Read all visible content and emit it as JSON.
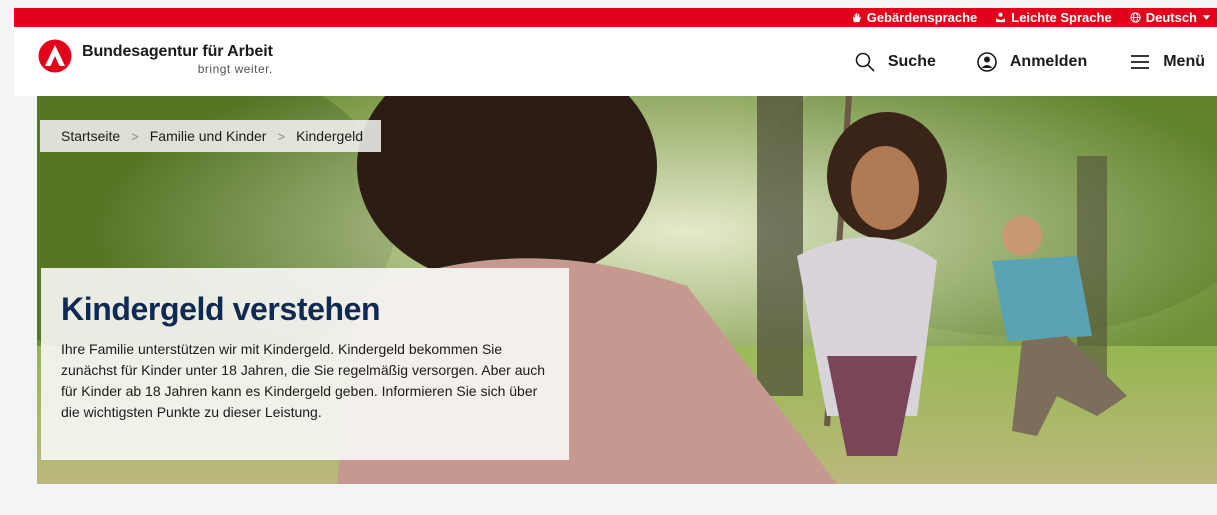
{
  "topbar": {
    "sign_language": "Gebärdensprache",
    "easy_language": "Leichte Sprache",
    "language": "Deutsch",
    "color": "#e2001a"
  },
  "header": {
    "brand_name": "Bundesagentur für Arbeit",
    "brand_claim": "bringt weiter.",
    "search_label": "Suche",
    "login_label": "Anmelden",
    "menu_label": "Menü"
  },
  "breadcrumb": {
    "items": [
      "Startseite",
      "Familie und Kinder",
      "Kindergeld"
    ],
    "separator": ">"
  },
  "hero": {
    "title": "Kindergeld verstehen",
    "text": "Ihre Familie unterstützen wir mit Kindergeld. Kindergeld bekommen Sie zunächst für Kinder unter 18 Jahren, die Sie regelmäßig versorgen. Aber auch für Kinder ab 18 Jahren kann es Kindergeld geben. Informieren Sie sich über die wichtigsten Punkte zu dieser Leistung."
  },
  "icons": {
    "sign_language": "hand-icon",
    "easy_language": "easy-language-icon",
    "language": "globe-icon",
    "search": "search-icon",
    "login": "user-circle-icon",
    "menu": "hamburger-icon",
    "logo": "ba-logo"
  }
}
